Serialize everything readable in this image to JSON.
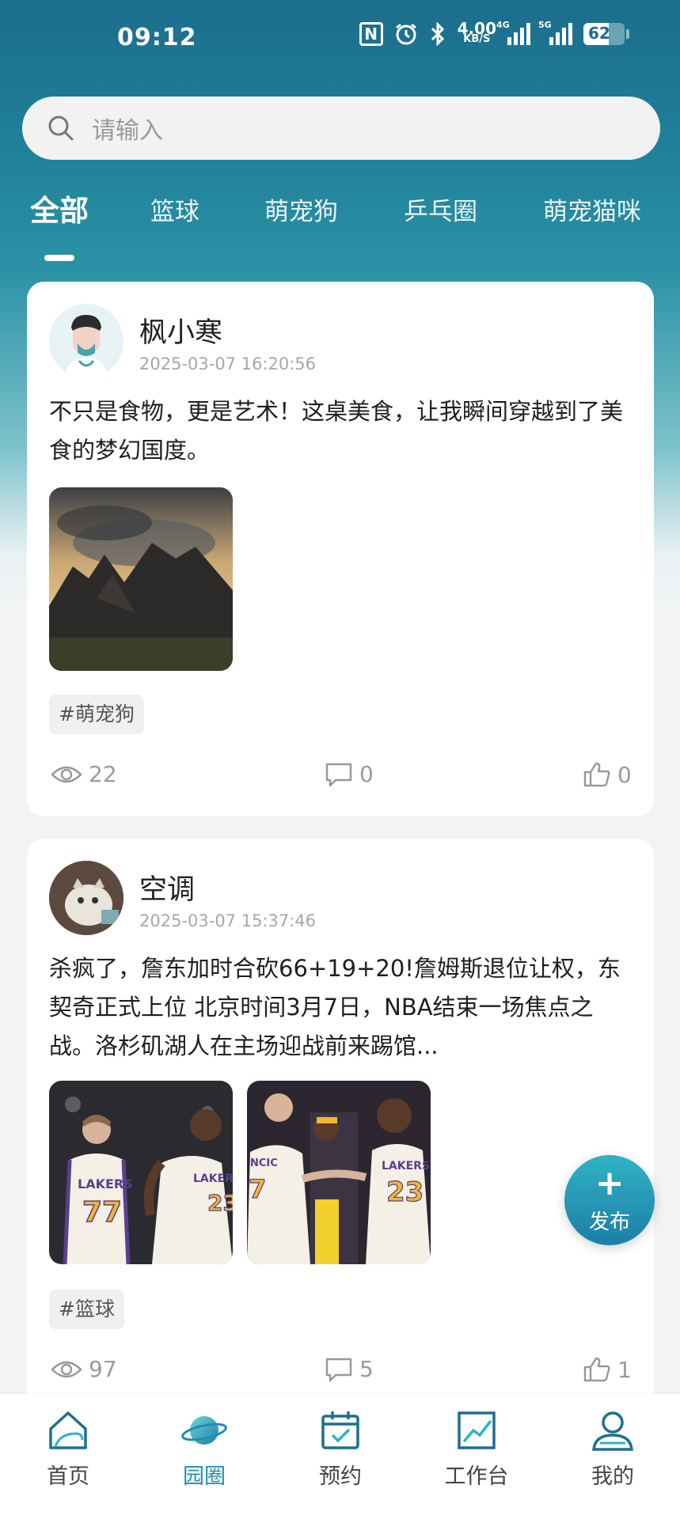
{
  "status_bar": {
    "time": "09:12",
    "speed_value": "4.00",
    "speed_unit": "KB/S",
    "net1": "4G",
    "net2": "5G",
    "battery": "62",
    "battery_level": 0.62
  },
  "search": {
    "placeholder": "请输入"
  },
  "tabs": [
    {
      "label": "全部",
      "active": true
    },
    {
      "label": "篮球"
    },
    {
      "label": "萌宠狗"
    },
    {
      "label": "乒乓圈"
    },
    {
      "label": "萌宠猫咪"
    }
  ],
  "posts": [
    {
      "username": "枫小寒",
      "time": "2025-03-07 16:20:56",
      "text": "不只是食物，更是艺术！这桌美食，让我瞬间穿越到了美食的梦幻国度。",
      "tag": "#萌宠狗",
      "views": "22",
      "comments": "0",
      "likes": "0"
    },
    {
      "username": "空调",
      "time": "2025-03-07 15:37:46",
      "text": "杀疯了，詹东加时合砍66+19+20!詹姆斯退位让权，东契奇正式上位 北京时间3月7日，NBA结束一场焦点之战。洛杉矶湖人在主场迎战前来踢馆...",
      "tag": "#篮球",
      "views": "97",
      "comments": "5",
      "likes": "1",
      "jersey1_team": "LAKERS",
      "jersey1_number": "77",
      "jersey2_team": "LAKERS",
      "jersey2_number": "23",
      "jersey3_team": "LAKERS",
      "jersey3_number": "23",
      "jersey4_name": "NCIC",
      "jersey4_number": "7"
    }
  ],
  "fab": {
    "plus": "+",
    "label": "发布"
  },
  "bottom_nav": [
    {
      "label": "首页"
    },
    {
      "label": "园圈",
      "active": true
    },
    {
      "label": "预约"
    },
    {
      "label": "工作台"
    },
    {
      "label": "我的"
    }
  ],
  "colors": {
    "accent": "#1e8fb2",
    "header_top": "#1b6e8c",
    "fab_top": "#2fb3c4",
    "fab_bottom": "#1d7ea6"
  }
}
